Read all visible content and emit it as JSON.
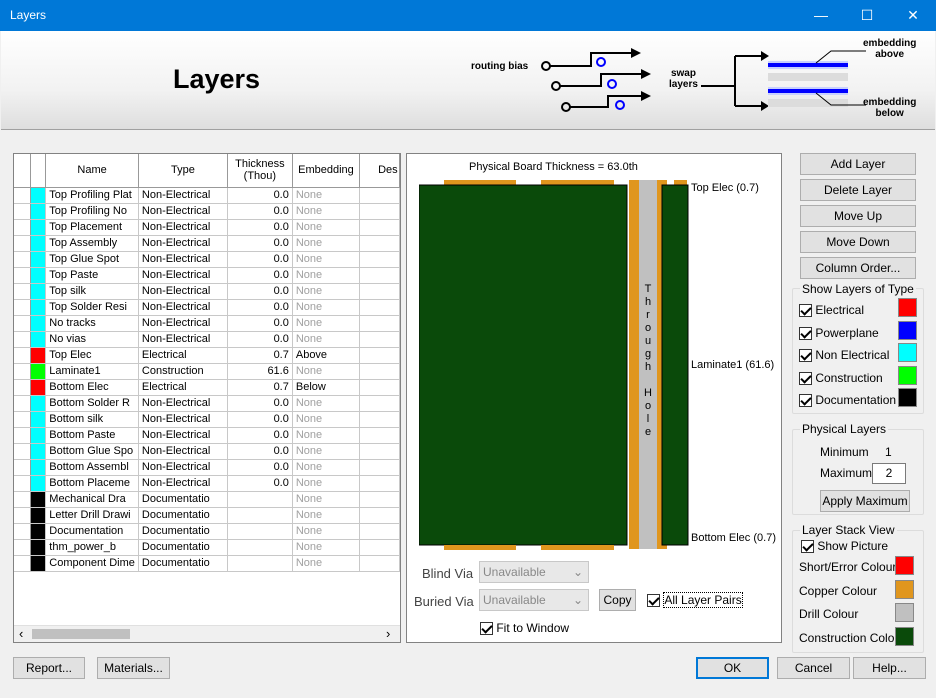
{
  "window": {
    "title": "Layers",
    "minimize": "—",
    "maximize": "☐",
    "close": "✕"
  },
  "banner": {
    "title": "Layers",
    "routing_bias": "routing bias",
    "swap": "swap",
    "layers": "layers",
    "embed_above_1": "embedding",
    "embed_above_2": "above",
    "embed_below_1": "embedding",
    "embed_below_2": "below"
  },
  "grid": {
    "headers": [
      "Name",
      "Type",
      "Thickness",
      "(Thou)",
      "Embedding",
      "Des"
    ],
    "rows": [
      {
        "color": "#00ffff",
        "name": "Top Profiling Plat",
        "type": "Non-Electrical",
        "thick": "0.0",
        "embed": "None"
      },
      {
        "color": "#00ffff",
        "name": "Top Profiling No",
        "type": "Non-Electrical",
        "thick": "0.0",
        "embed": "None"
      },
      {
        "color": "#00ffff",
        "name": "Top Placement",
        "type": "Non-Electrical",
        "thick": "0.0",
        "embed": "None"
      },
      {
        "color": "#00ffff",
        "name": "Top Assembly",
        "type": "Non-Electrical",
        "thick": "0.0",
        "embed": "None"
      },
      {
        "color": "#00ffff",
        "name": "Top Glue Spot",
        "type": "Non-Electrical",
        "thick": "0.0",
        "embed": "None"
      },
      {
        "color": "#00ffff",
        "name": "Top Paste",
        "type": "Non-Electrical",
        "thick": "0.0",
        "embed": "None"
      },
      {
        "color": "#00ffff",
        "name": "Top silk",
        "type": "Non-Electrical",
        "thick": "0.0",
        "embed": "None"
      },
      {
        "color": "#00ffff",
        "name": "Top Solder Resi",
        "type": "Non-Electrical",
        "thick": "0.0",
        "embed": "None"
      },
      {
        "color": "#00ffff",
        "name": "No tracks",
        "type": "Non-Electrical",
        "thick": "0.0",
        "embed": "None"
      },
      {
        "color": "#00ffff",
        "name": "No vias",
        "type": "Non-Electrical",
        "thick": "0.0",
        "embed": "None"
      },
      {
        "color": "#ff0000",
        "name": "Top Elec",
        "type": "Electrical",
        "thick": "0.7",
        "embed": "Above"
      },
      {
        "color": "#00ff00",
        "name": "Laminate1",
        "type": "Construction",
        "thick": "61.6",
        "embed": "None"
      },
      {
        "color": "#ff0000",
        "name": "Bottom Elec",
        "type": "Electrical",
        "thick": "0.7",
        "embed": "Below"
      },
      {
        "color": "#00ffff",
        "name": "Bottom Solder R",
        "type": "Non-Electrical",
        "thick": "0.0",
        "embed": "None"
      },
      {
        "color": "#00ffff",
        "name": "Bottom silk",
        "type": "Non-Electrical",
        "thick": "0.0",
        "embed": "None"
      },
      {
        "color": "#00ffff",
        "name": "Bottom Paste",
        "type": "Non-Electrical",
        "thick": "0.0",
        "embed": "None"
      },
      {
        "color": "#00ffff",
        "name": "Bottom Glue Spo",
        "type": "Non-Electrical",
        "thick": "0.0",
        "embed": "None"
      },
      {
        "color": "#00ffff",
        "name": "Bottom Assembl",
        "type": "Non-Electrical",
        "thick": "0.0",
        "embed": "None"
      },
      {
        "color": "#00ffff",
        "name": "Bottom Placeme",
        "type": "Non-Electrical",
        "thick": "0.0",
        "embed": "None"
      },
      {
        "color": "#000000",
        "name": "Mechanical Dra",
        "type": "Documentatio",
        "thick": "",
        "embed": "None"
      },
      {
        "color": "#000000",
        "name": "Letter Drill Drawi",
        "type": "Documentatio",
        "thick": "",
        "embed": "None"
      },
      {
        "color": "#000000",
        "name": "Documentation",
        "type": "Documentatio",
        "thick": "",
        "embed": "None"
      },
      {
        "color": "#000000",
        "name": "thm_power_b",
        "type": "Documentatio",
        "thick": "",
        "embed": "None"
      },
      {
        "color": "#000000",
        "name": "Component Dime",
        "type": "Documentatio",
        "thick": "",
        "embed": "None"
      }
    ],
    "scroll_left": "‹",
    "scroll_right": "›"
  },
  "board": {
    "thickness_label": "Physical Board Thickness = 63.0th",
    "top": "Top Elec (0.7)",
    "laminate": "Laminate1 (61.6)",
    "bottom": "Bottom Elec (0.7)",
    "through_hole": [
      "T",
      "h",
      "r",
      "o",
      "u",
      "g",
      "h",
      "",
      "H",
      "o",
      "l",
      "e"
    ],
    "blind_via": "Blind Via",
    "buried_via": "Buried Via",
    "unavailable": "Unavailable",
    "copy": "Copy",
    "all_layer_pairs": "All Layer Pairs",
    "fit": "Fit to Window",
    "colors": {
      "laminate": "#0a4a0a",
      "copper": "#e0961e",
      "drill": "#c0c0c0"
    }
  },
  "buttons": {
    "add": "Add Layer",
    "delete": "Delete Layer",
    "up": "Move Up",
    "down": "Move Down",
    "order": "Column Order...",
    "apply": "Apply Maximum",
    "report": "Report...",
    "materials": "Materials...",
    "ok": "OK",
    "cancel": "Cancel",
    "help": "Help..."
  },
  "show_types": {
    "title": "Show Layers of Type",
    "items": [
      {
        "label": "Electrical",
        "color": "#ff0000"
      },
      {
        "label": "Powerplane",
        "color": "#0000ff"
      },
      {
        "label": "Non Electrical",
        "color": "#00ffff"
      },
      {
        "label": "Construction",
        "color": "#00ff00"
      },
      {
        "label": "Documentation",
        "color": "#000000"
      }
    ]
  },
  "physical": {
    "title": "Physical Layers",
    "min_label": "Minimum",
    "min_value": "1",
    "max_label": "Maximum",
    "max_value": "2"
  },
  "stack": {
    "title": "Layer Stack View",
    "show_picture": "Show Picture",
    "items": [
      {
        "label": "Short/Error Colour",
        "color": "#ff0000"
      },
      {
        "label": "Copper Colour",
        "color": "#e0961e"
      },
      {
        "label": "Drill Colour",
        "color": "#c0c0c0"
      },
      {
        "label": "Construction Colour",
        "color": "#0a4a0a"
      }
    ]
  }
}
